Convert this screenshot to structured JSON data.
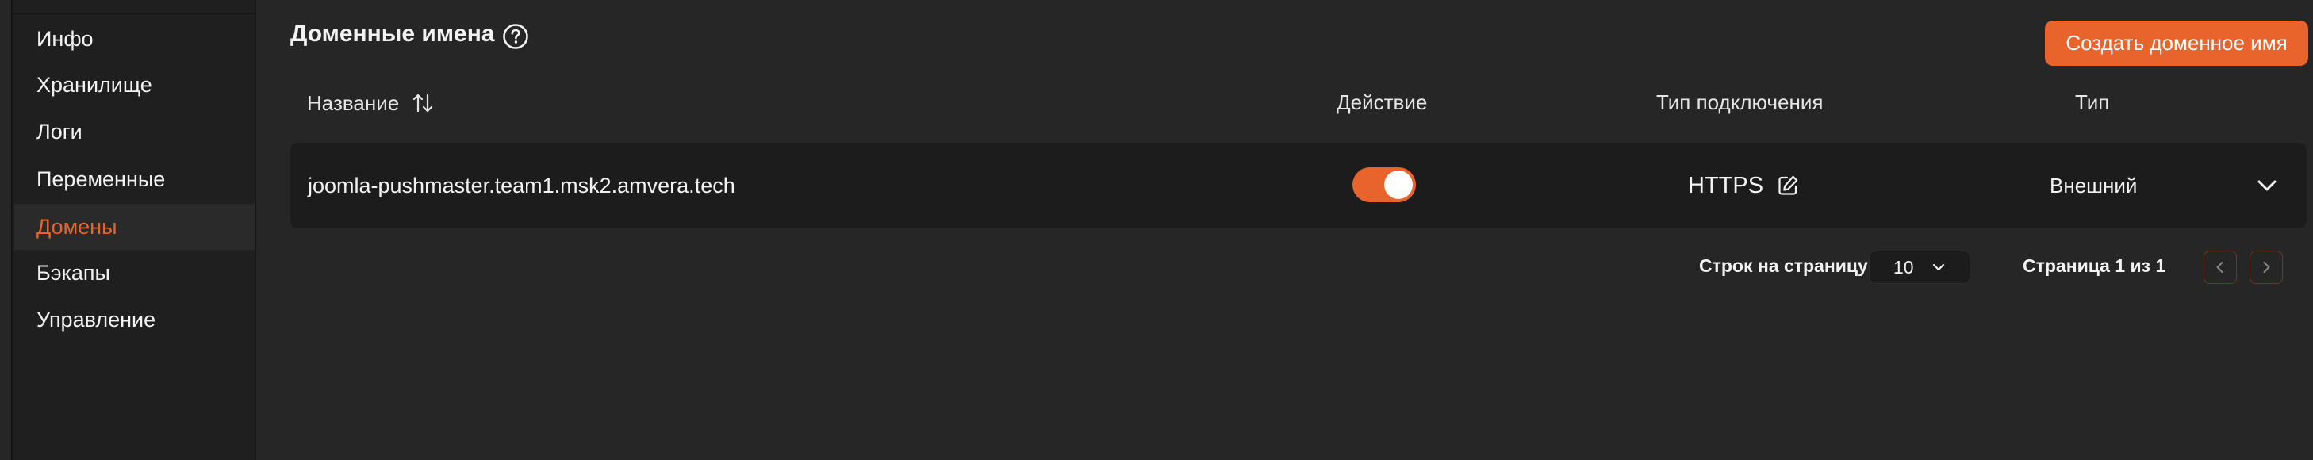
{
  "sidebar": {
    "items": [
      {
        "label": "Инфо"
      },
      {
        "label": "Хранилище"
      },
      {
        "label": "Логи"
      },
      {
        "label": "Переменные"
      },
      {
        "label": "Домены",
        "active": true
      },
      {
        "label": "Бэкапы"
      },
      {
        "label": "Управление"
      }
    ]
  },
  "header": {
    "title": "Доменные имена",
    "create_button": "Создать доменное имя"
  },
  "table": {
    "columns": [
      "Название",
      "Действие",
      "Тип подключения",
      "Тип"
    ],
    "rows": [
      {
        "name": "joomla-pushmaster.team1.msk2.amvera.tech",
        "enabled": true,
        "connection_type": "HTTPS",
        "type": "Внешний"
      }
    ]
  },
  "pagination": {
    "rows_per_page_label": "Строк на страницу",
    "rows_per_page": "10",
    "page_info": "Страница 1 из 1"
  },
  "colors": {
    "accent": "#e8642c",
    "background": "#262626",
    "sidebar": "#1f1f1f",
    "row": "#1c1c1c"
  }
}
